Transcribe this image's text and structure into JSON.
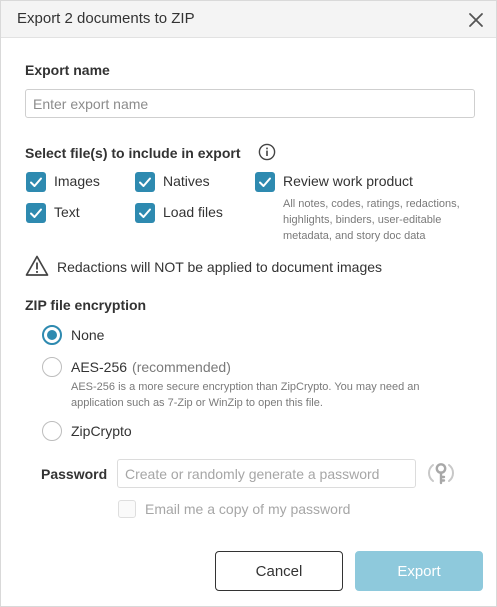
{
  "dialog": {
    "title": "Export 2 documents to ZIP"
  },
  "export_name": {
    "label": "Export name",
    "placeholder": "Enter export name",
    "value": ""
  },
  "files": {
    "label": "Select file(s) to include in export",
    "items": [
      {
        "label": "Images",
        "checked": true
      },
      {
        "label": "Natives",
        "checked": true
      },
      {
        "label": "Review work product",
        "checked": true
      },
      {
        "label": "Text",
        "checked": true
      },
      {
        "label": "Load files",
        "checked": true
      }
    ],
    "review_help_line1": "All notes, codes, ratings, redactions,",
    "review_help_line2": "highlights, binders, user-editable",
    "review_help_line3": "metadata, and story doc data"
  },
  "warning": {
    "text": "Redactions will NOT be applied to document images"
  },
  "encryption": {
    "label": "ZIP file encryption",
    "selected": "None",
    "options": [
      {
        "label": "None"
      },
      {
        "label": "AES-256",
        "note": "(recommended)"
      },
      {
        "label": "ZipCrypto"
      }
    ],
    "aes_help_line1": "AES-256 is a more secure encryption than ZipCrypto. You may need an",
    "aes_help_line2": "application such as 7-Zip or WinZip to open this file."
  },
  "password": {
    "label": "Password",
    "placeholder": "Create or randomly generate a password",
    "email_label": "Email me a copy of my password"
  },
  "footer": {
    "cancel_label": "Cancel",
    "export_label": "Export"
  },
  "colors": {
    "accent": "#2e8ab0",
    "export_disabled": "#8ec9dc",
    "header_bg": "#f4f4f4"
  }
}
